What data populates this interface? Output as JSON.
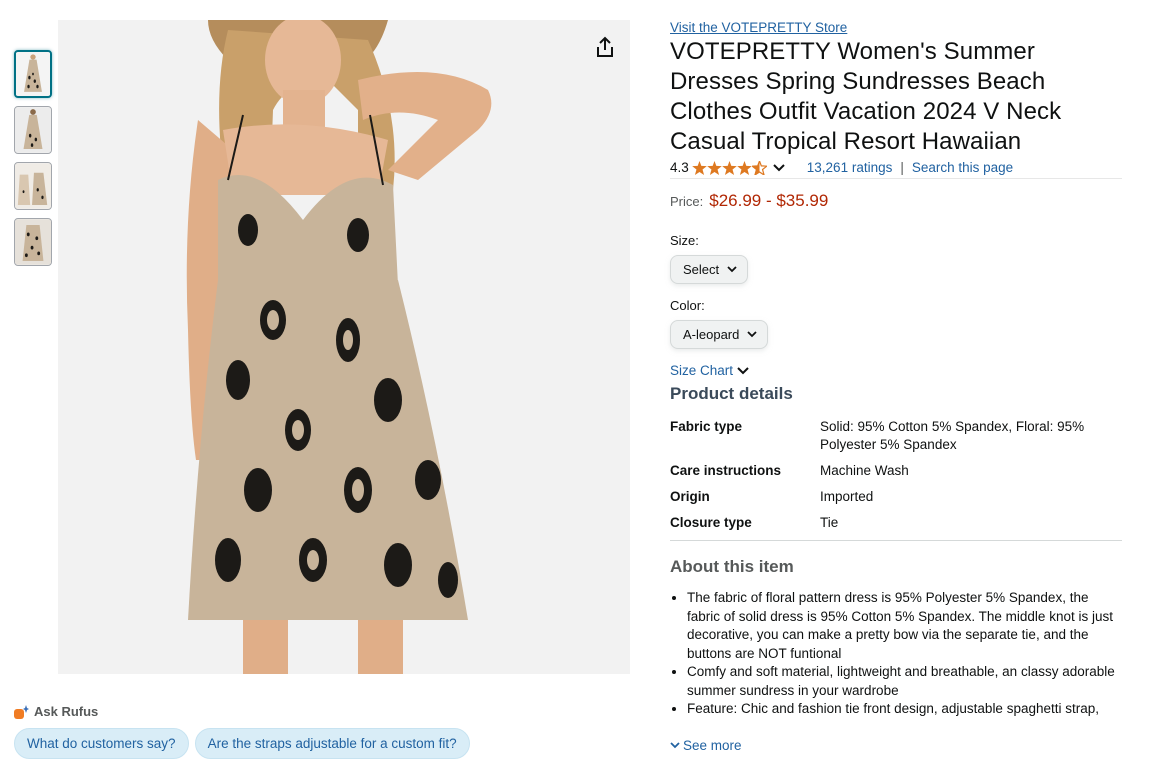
{
  "thumbnails": [
    {
      "name": "thumbnail-1",
      "selected": true
    },
    {
      "name": "thumbnail-2",
      "selected": false
    },
    {
      "name": "thumbnail-3",
      "selected": false
    },
    {
      "name": "thumbnail-4",
      "selected": false
    }
  ],
  "icons": {
    "share": "share-icon",
    "rufus": "rufus-icon",
    "star": "star-icon",
    "chevron": "chevron-down-icon"
  },
  "rufus": {
    "label": "Ask Rufus",
    "chips": [
      "What do customers say?",
      "Are the straps adjustable for a custom fit?"
    ]
  },
  "product": {
    "store_link": "Visit the VOTEPRETTY Store",
    "title": "VOTEPRETTY Women's Summer Dresses Spring Sundresses Beach Clothes Outfit Vacation 2024 V Neck Casual Tropical Resort Hawaiian",
    "rating_value": "4.3",
    "rating_stars": 4.3,
    "ratings_count": "13,261 ratings",
    "separator": "|",
    "search_page": "Search this page",
    "price_label": "Price:",
    "price": "$26.99 - $35.99"
  },
  "options": {
    "size_label": "Size:",
    "size_value": "Select",
    "color_label": "Color:",
    "color_value": "A-leopard",
    "size_chart": "Size Chart"
  },
  "details": {
    "heading": "Product details",
    "rows": [
      {
        "key": "Fabric type",
        "value": "Solid: 95% Cotton 5% Spandex, Floral: 95% Polyester 5% Spandex"
      },
      {
        "key": "Care instructions",
        "value": "Machine Wash"
      },
      {
        "key": "Origin",
        "value": "Imported"
      },
      {
        "key": "Closure type",
        "value": "Tie"
      }
    ]
  },
  "about": {
    "heading": "About this item",
    "bullets": [
      "The fabric of floral pattern dress is 95% Polyester 5% Spandex, the fabric of solid dress is 95% Cotton 5% Spandex. The middle knot is just decorative, you can make a pretty bow via the separate tie, and the buttons are NOT funtional",
      "Comfy and soft material, lightweight and breathable, an classy adorable summer sundress in your wardrobe",
      "Feature: Chic and fashion tie front design, adjustable spaghetti strap,"
    ],
    "see_more": "See more"
  },
  "colors": {
    "link": "#2162a1",
    "price": "#b12704",
    "star": "#de7921",
    "chip_bg": "#d9edf7",
    "dress_tan": "#c8b49a",
    "leopard_spot": "#1c1a17"
  }
}
